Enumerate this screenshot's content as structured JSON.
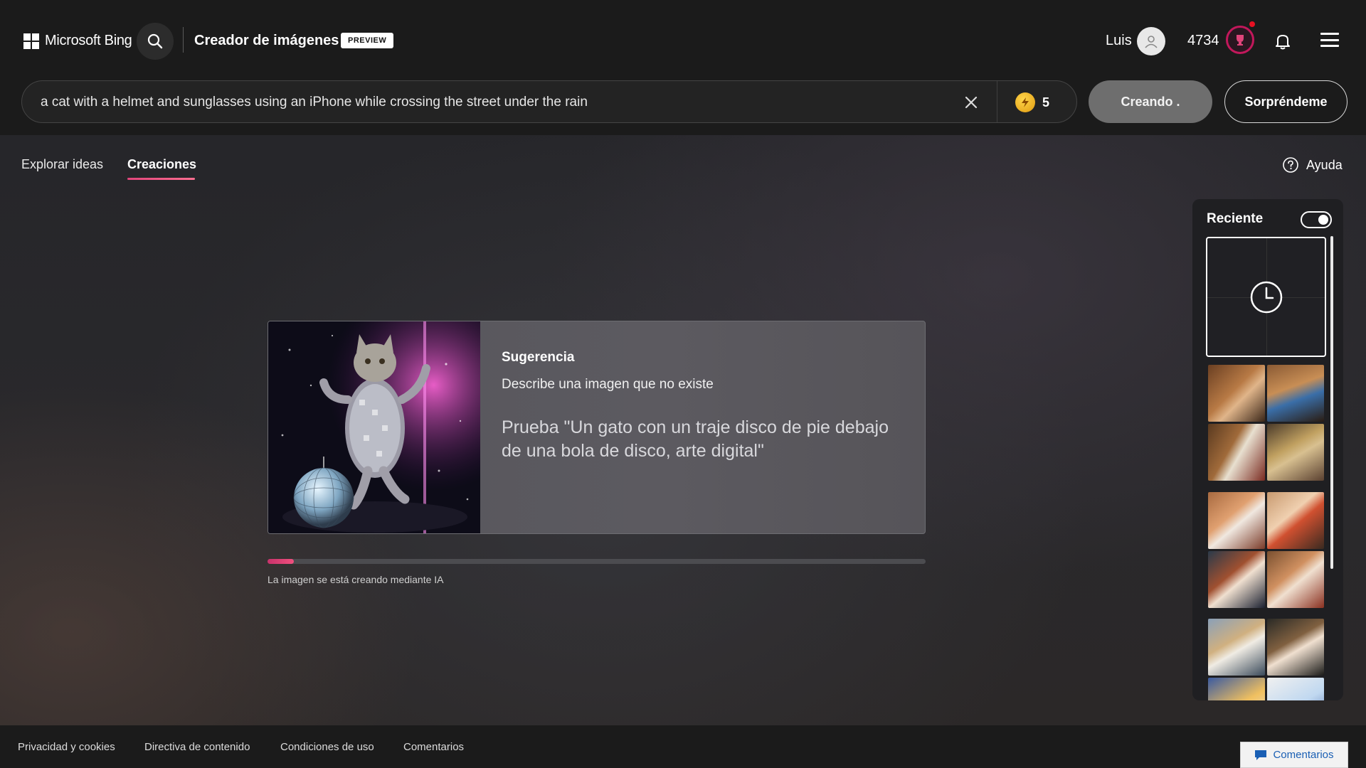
{
  "header": {
    "brand": "Microsoft Bing",
    "app_title": "Creador de imágenes",
    "badge": "PREVIEW",
    "user_name": "Luis",
    "points": "4734"
  },
  "prompt": {
    "value": "a cat with a helmet and sunglasses using an iPhone while crossing the street under the rain",
    "boosts": "5",
    "create_label": "Creando .",
    "surprise_label": "Sorpréndeme"
  },
  "tabs": [
    {
      "label": "Explorar ideas",
      "active": false
    },
    {
      "label": "Creaciones",
      "active": true
    }
  ],
  "help_label": "Ayuda",
  "suggestion": {
    "title": "Sugerencia",
    "subtitle": "Describe una imagen que no existe",
    "quote": "Prueba \"Un gato con un traje disco de pie debajo de una bola de disco, arte digital\""
  },
  "progress": {
    "fraction": 0.04,
    "label": "La imagen se está creando mediante IA"
  },
  "recent": {
    "title": "Reciente",
    "toggle_on": true
  },
  "footer": {
    "links": [
      "Privacidad y cookies",
      "Directiva de contenido",
      "Condiciones de uso",
      "Comentarios"
    ],
    "feedback_label": "Comentarios"
  },
  "colors": {
    "accent": "#e0457b",
    "reward_ring": "#c2185b",
    "boost_coin": "#f5b82e"
  }
}
